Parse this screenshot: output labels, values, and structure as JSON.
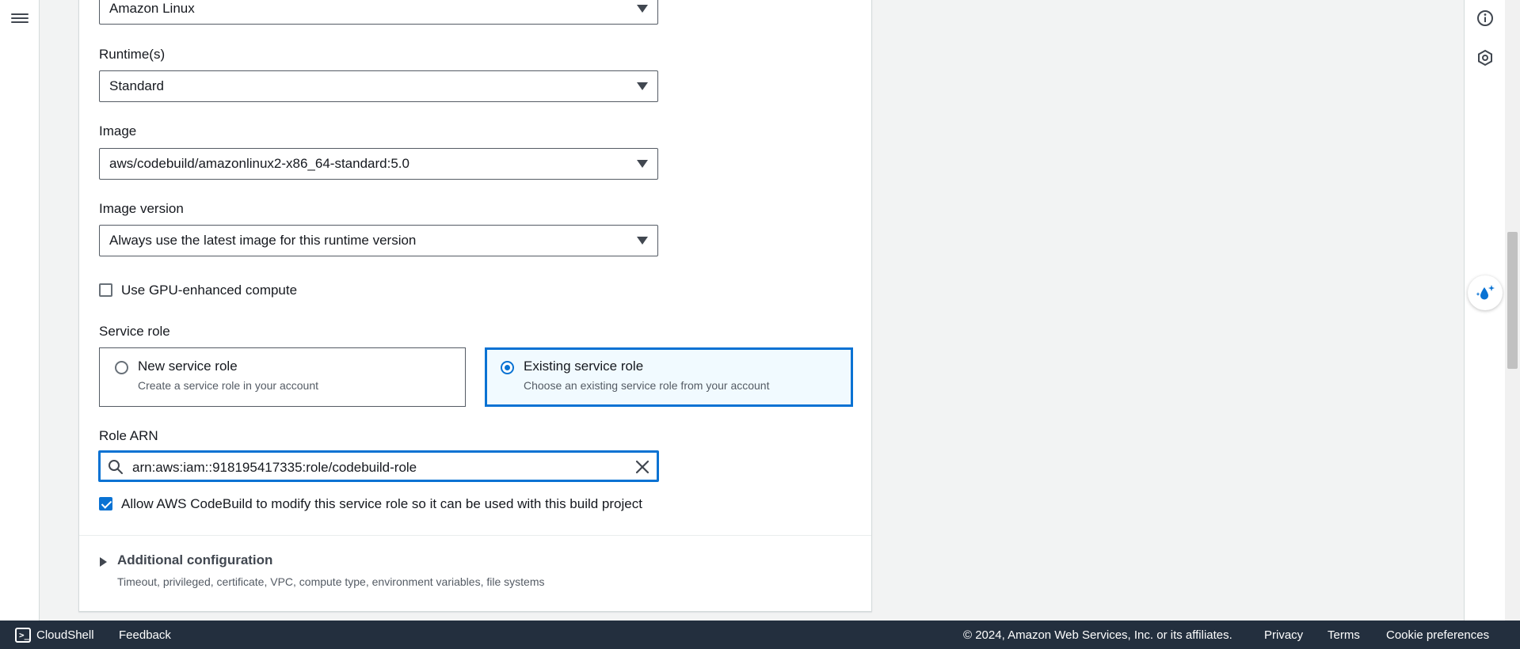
{
  "form": {
    "operating_system": {
      "value": "Amazon Linux"
    },
    "runtime": {
      "label": "Runtime(s)",
      "value": "Standard"
    },
    "image": {
      "label": "Image",
      "value": "aws/codebuild/amazonlinux2-x86_64-standard:5.0"
    },
    "image_version": {
      "label": "Image version",
      "value": "Always use the latest image for this runtime version"
    },
    "gpu": {
      "label": "Use GPU-enhanced compute",
      "checked": false
    },
    "service_role": {
      "label": "Service role",
      "options": [
        {
          "title": "New service role",
          "description": "Create a service role in your account",
          "selected": false
        },
        {
          "title": "Existing service role",
          "description": "Choose an existing service role from your account",
          "selected": true
        }
      ]
    },
    "role_arn": {
      "label": "Role ARN",
      "value": "arn:aws:iam::918195417335:role/codebuild-role"
    },
    "allow_modify": {
      "label": "Allow AWS CodeBuild to modify this service role so it can be used with this build project",
      "checked": true
    },
    "additional_config": {
      "title": "Additional configuration",
      "description": "Timeout, privileged, certificate, VPC, compute type, environment variables, file systems"
    }
  },
  "footer": {
    "cloudshell": "CloudShell",
    "feedback": "Feedback",
    "copyright": "© 2024, Amazon Web Services, Inc. or its affiliates.",
    "privacy": "Privacy",
    "terms": "Terms",
    "cookie": "Cookie preferences"
  },
  "icons": {
    "menu": "hamburger-menu-icon",
    "info": "info-icon",
    "security": "shield-settings-icon",
    "assistant": "ai-assistant-icon",
    "search": "search-icon",
    "clear": "close-icon",
    "cloudshell": "terminal-icon"
  },
  "colors": {
    "accent": "#0972d3",
    "footer_bg": "#232f3e",
    "page_bg": "#f2f3f3"
  }
}
